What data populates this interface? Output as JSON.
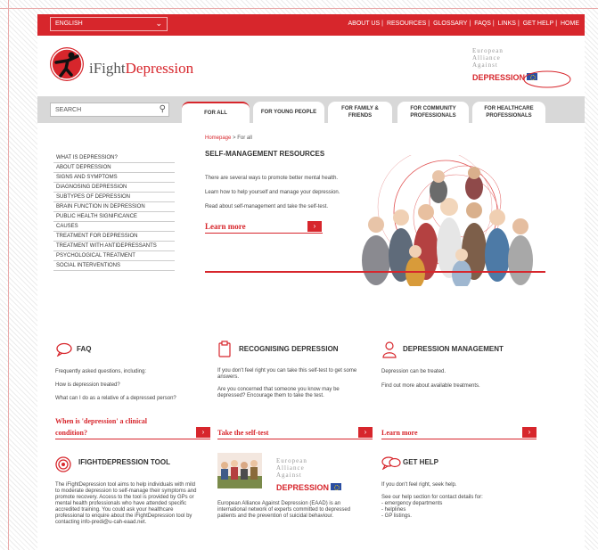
{
  "topbar": {
    "language": "ENGLISH",
    "links": [
      "ABOUT US",
      "RESOURCES",
      "GLOSSARY",
      "FAQS",
      "LINKS",
      "GET HELP",
      "HOME"
    ]
  },
  "header": {
    "logo_prefix": "iFight",
    "logo_suffix": "Depression",
    "partner_line1": "European",
    "partner_line2": "Alliance",
    "partner_line3": "Against",
    "partner_big": "DEPRESSION"
  },
  "nav": {
    "search_placeholder": "SEARCH",
    "tabs": [
      "FOR ALL",
      "FOR YOUNG PEOPLE",
      "FOR FAMILY & FRIENDS",
      "FOR COMMUNITY PROFESSIONALS",
      "FOR HEALTHCARE PROFESSIONALS"
    ]
  },
  "sidebar": {
    "items": [
      "WHAT IS DEPRESSION?",
      "ABOUT DEPRESSION",
      "SIGNS AND SYMPTOMS",
      "DIAGNOSING DEPRESSION",
      "SUBTYPES OF DEPRESSION",
      "BRAIN FUNCTION IN DEPRESSION",
      "PUBLIC HEALTH SIGNIFICANCE",
      "CAUSES",
      "TREATMENT FOR DEPRESSION",
      "TREATMENT WITH ANTIDEPRESSANTS",
      "PSYCHOLOGICAL TREATMENT",
      "SOCIAL INTERVENTIONS"
    ]
  },
  "main": {
    "breadcrumb_home": "Homepage",
    "breadcrumb_sep": " > ",
    "breadcrumb_current": "For all",
    "title": "SELF-MANAGEMENT RESOURCES",
    "lines": [
      "There are several ways to promote better mental health.",
      "Learn how to help yourself and manage your depression.",
      "Read about self-management and take the self-test."
    ],
    "learn_more": "Learn more"
  },
  "blocks": {
    "faq": {
      "title": "FAQ",
      "l1": "Frequently asked questions, including:",
      "l2": "How is depression treated?",
      "l3": "What can I do as a relative of a depressed person?",
      "link1": "When is 'depression' a clinical",
      "link2": "condition?"
    },
    "recognising": {
      "title": "RECOGNISING DEPRESSION",
      "l1": "If you don't feel right you can take this self-test to get some",
      "l1b": "answers.",
      "l2": "Are you concerned that someone you know may be",
      "l2b": "depressed? Encourage them to take the test.",
      "link": "Take the self-test"
    },
    "management": {
      "title": "DEPRESSION MANAGEMENT",
      "l1": "Depression can be treated.",
      "l2": "Find out more about available treatments.",
      "link": "Learn more"
    },
    "tool": {
      "title": "IFIGHTDEPRESSION TOOL",
      "lines": [
        "The iFightDepression tool aims to help individuals with mild",
        "to moderate depression to self-manage their symptoms and",
        "promote recovery. Access to the tool is provided by GPs or",
        "mental health professionals who have attended specific",
        "accredited training. You could ask your healthcare",
        "professional to enquire about the iFightDepression tool by",
        "contacting info-predi@u-cah-eaad.net."
      ]
    },
    "eaad": {
      "line1": "European",
      "line2": "Alliance",
      "line3": "Against",
      "big": "DEPRESSION",
      "lines": [
        "European Alliance Against Depression (EAAD) is an",
        "international network of experts committed to depressed",
        "patients and the prevention of suicidal behaviour."
      ]
    },
    "help": {
      "title": "GET HELP",
      "lines": [
        "If you don't feel right, seek help.",
        "See our help section for contact details for:",
        "- emergency departments",
        "- helplines",
        "- GP listings."
      ]
    }
  },
  "colors": {
    "accent": "#d7262c",
    "nav_bg": "#d8d8d8"
  }
}
